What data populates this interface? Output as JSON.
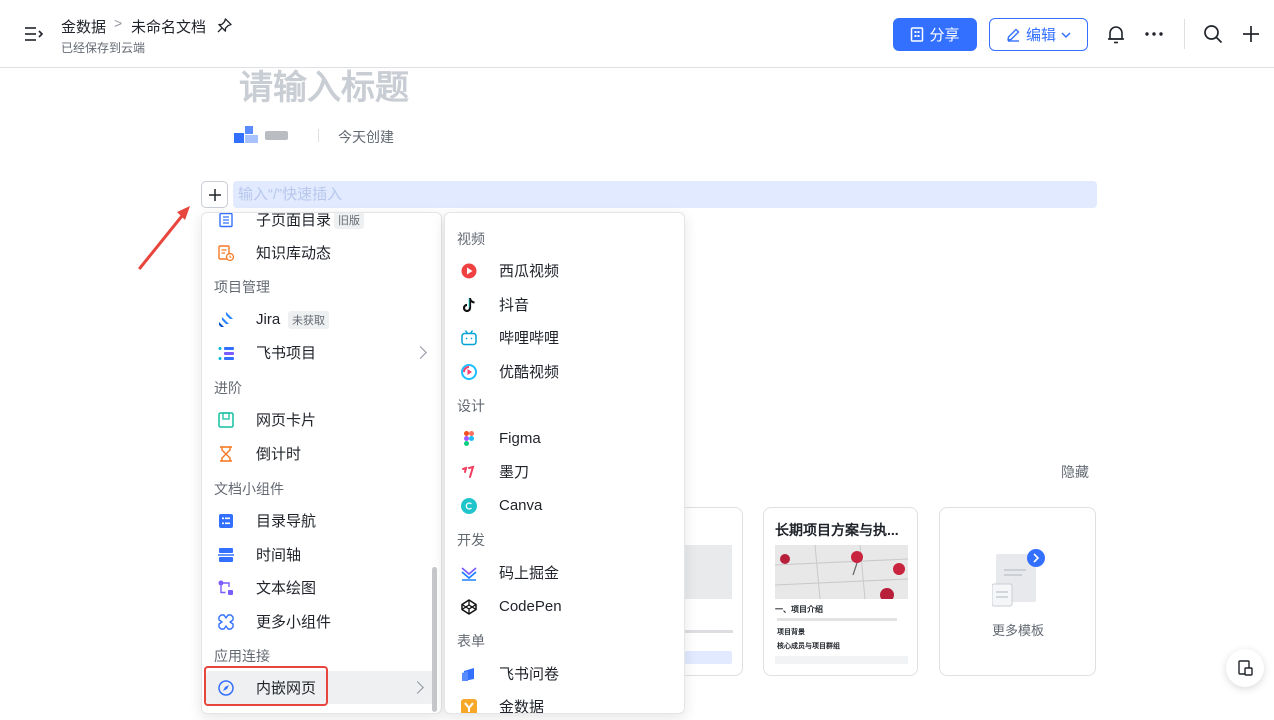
{
  "header": {
    "breadcrumb_root": "金数据",
    "breadcrumb_sep": ">",
    "doc_title": "未命名文档",
    "save_status": "已经保存到云端",
    "share_label": "分享",
    "edit_label": "编辑",
    "accent": "#3370ff"
  },
  "doc": {
    "title_placeholder": "请输入标题",
    "created": "今天创建",
    "input_placeholder": "输入“/”快速插入"
  },
  "templates": {
    "hide_label": "隐藏",
    "card_title": "长期项目方案与执...",
    "card_heading": "一、项目介绍",
    "card_row1": "项目背景",
    "card_row2": "核心成员与项目群组",
    "more_label": "更多模板"
  },
  "menu_left": {
    "items": [
      {
        "label": "子页面目录",
        "tag": "旧版",
        "icon": "list-icon"
      },
      {
        "label": "知识库动态",
        "icon": "wiki-activity-icon"
      },
      {
        "section": "项目管理"
      },
      {
        "label": "Jira",
        "tag": "未获取",
        "icon": "jira-icon"
      },
      {
        "label": "飞书项目",
        "icon": "feishu-project-icon",
        "submenu": true
      },
      {
        "section": "进阶"
      },
      {
        "label": "网页卡片",
        "icon": "web-card-icon"
      },
      {
        "label": "倒计时",
        "icon": "hourglass-icon"
      },
      {
        "section": "文档小组件"
      },
      {
        "label": "目录导航",
        "icon": "toc-icon"
      },
      {
        "label": "时间轴",
        "icon": "timeline-icon"
      },
      {
        "label": "文本绘图",
        "icon": "text-diagram-icon"
      },
      {
        "label": "更多小组件",
        "icon": "more-widgets-icon"
      },
      {
        "section": "应用连接"
      },
      {
        "label": "内嵌网页",
        "icon": "compass-icon",
        "submenu": true,
        "active": true
      }
    ]
  },
  "menu_right": {
    "items": [
      {
        "section": "视频"
      },
      {
        "label": "西瓜视频",
        "icon": "xigua-icon"
      },
      {
        "label": "抖音",
        "icon": "douyin-icon"
      },
      {
        "label": "哔哩哔哩",
        "icon": "bilibili-icon"
      },
      {
        "label": "优酷视频",
        "icon": "youku-icon"
      },
      {
        "section": "设计"
      },
      {
        "label": "Figma",
        "icon": "figma-icon"
      },
      {
        "label": "墨刀",
        "icon": "modao-icon"
      },
      {
        "label": "Canva",
        "icon": "canva-icon"
      },
      {
        "section": "开发"
      },
      {
        "label": "码上掘金",
        "icon": "juejin-icon"
      },
      {
        "label": "CodePen",
        "icon": "codepen-icon"
      },
      {
        "section": "表单"
      },
      {
        "label": "飞书问卷",
        "icon": "feishu-survey-icon"
      },
      {
        "label": "金数据",
        "icon": "jinshuju-icon"
      }
    ]
  }
}
